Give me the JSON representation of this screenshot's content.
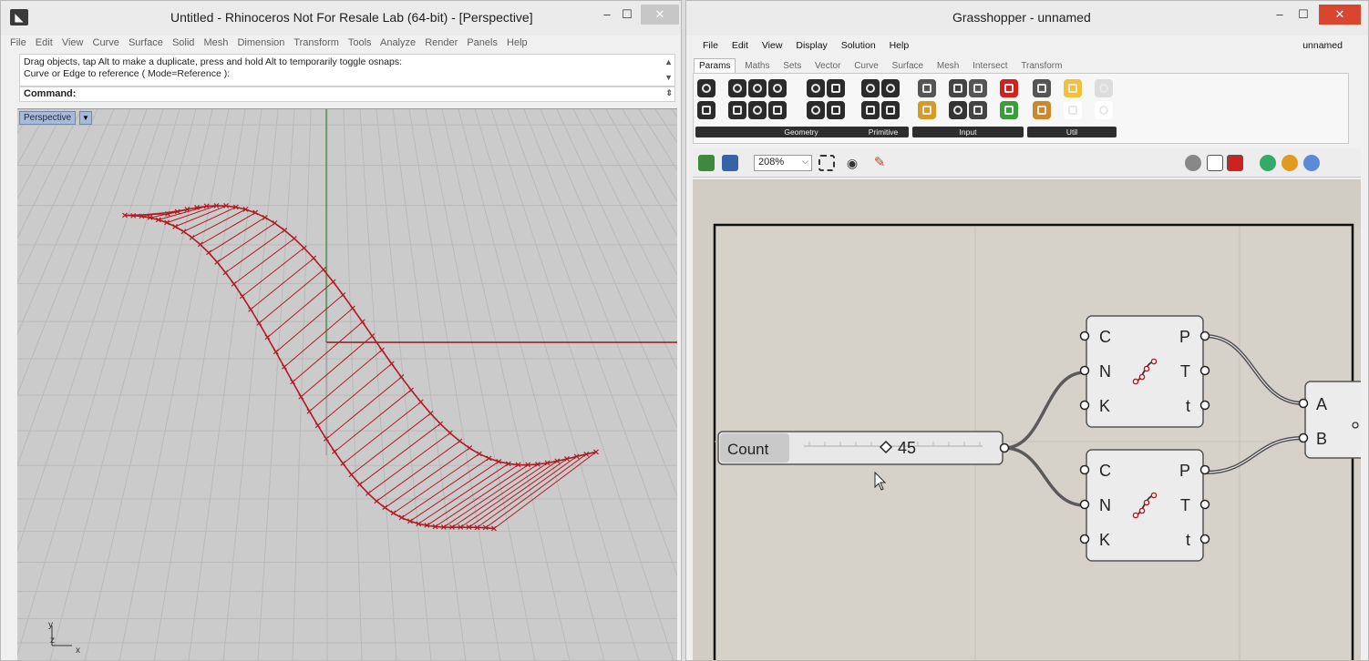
{
  "rhino": {
    "title": "Untitled - Rhinoceros Not For Resale Lab (64-bit) - [Perspective]",
    "menu": [
      "File",
      "Edit",
      "View",
      "Curve",
      "Surface",
      "Solid",
      "Mesh",
      "Dimension",
      "Transform",
      "Tools",
      "Analyze",
      "Render",
      "Panels",
      "Help"
    ],
    "history_line1": "Drag objects, tap Alt to make a duplicate, press and hold Alt to temporarily toggle osnaps:",
    "history_line2": "Curve or Edge to reference ( Mode=Reference ):",
    "command_label": "Command:",
    "viewport_name": "Perspective",
    "axis_y": "y",
    "axis_z": "z",
    "axis_x": "x",
    "colors": {
      "curve": "#b01a22",
      "grid": "#b9b9b9",
      "x_axis": "#8f1a1a",
      "y_axis": "#1e7a1e"
    }
  },
  "gh": {
    "title": "Grasshopper - unnamed",
    "menu": [
      "File",
      "Edit",
      "View",
      "Display",
      "Solution",
      "Help"
    ],
    "doc_name": "unnamed",
    "tabs": [
      "Params",
      "Maths",
      "Sets",
      "Vector",
      "Curve",
      "Surface",
      "Mesh",
      "Intersect",
      "Transform"
    ],
    "groups": [
      "Geometry",
      "Primitive",
      "Input",
      "Util"
    ],
    "zoom": "208%",
    "slider": {
      "label": "Count",
      "value": "45"
    },
    "components": [
      {
        "inputs": [
          "C",
          "N",
          "K"
        ],
        "outputs": [
          "P",
          "T",
          "t"
        ]
      },
      {
        "inputs": [
          "C",
          "N",
          "K"
        ],
        "outputs": [
          "P",
          "T",
          "t"
        ]
      }
    ],
    "partial_component_inputs": [
      "A",
      "B"
    ],
    "colors": {
      "canvas": "#d5d0c7",
      "node": "#ececec",
      "wire": "#5a5a5a"
    }
  }
}
